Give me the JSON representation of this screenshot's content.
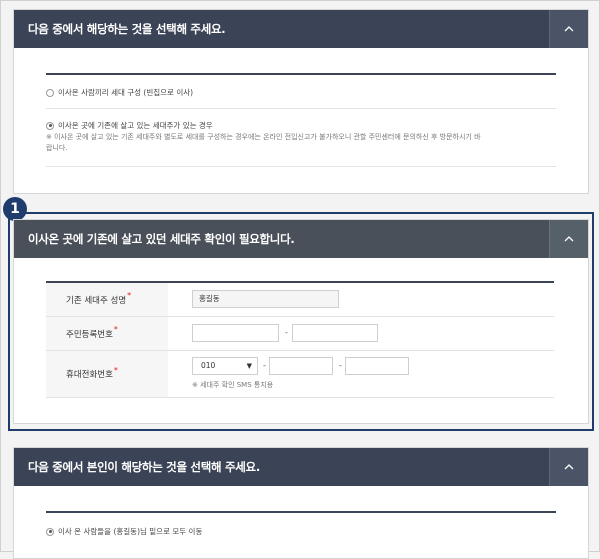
{
  "badge": "1",
  "section1": {
    "title": "다음 중에서 해당하는 것을 선택해 주세요.",
    "options": [
      {
        "label": "이사온 사람끼리 세대 구성 (빈집으로 이사)",
        "selected": false
      },
      {
        "label": "이사온 곳에 기존에 살고 있는 세대주가 있는 경우",
        "selected": true
      }
    ],
    "note_line1": "※ 이사온 곳에 살고 있는 기존 세대주와 별도로 세대를 구성하는 경우에는 온라인 전입신고가 불가하오니 관할 주민센터에 문의하신 후 방문하시기 바",
    "note_line2": "랍니다."
  },
  "section2": {
    "title": "이사온 곳에 기존에 살고 있던 세대주 확인이 필요합니다.",
    "fields": {
      "householder_name": {
        "label": "기존 세대주 성명",
        "value": "홍길동"
      },
      "resident_number": {
        "label": "주민등록번호",
        "part1": "",
        "part2": "",
        "separator": "-"
      },
      "mobile": {
        "label": "휴대전화번호",
        "prefix": "010",
        "part2": "",
        "part3": "",
        "separator": "-",
        "hint": "※ 세대주 확인 SMS 통지용"
      }
    },
    "required_mark": "*"
  },
  "section3": {
    "title": "다음 중에서 본인이 해당하는 것을 선택해 주세요.",
    "option": {
      "label": "이사 온 사람들을 (홍길동)님 밑으로 모두 이동",
      "selected": true
    }
  },
  "colors": {
    "header": "#3b4356",
    "header_dark": "#495059",
    "highlight": "#1f3c6d",
    "required": "#e02020"
  }
}
